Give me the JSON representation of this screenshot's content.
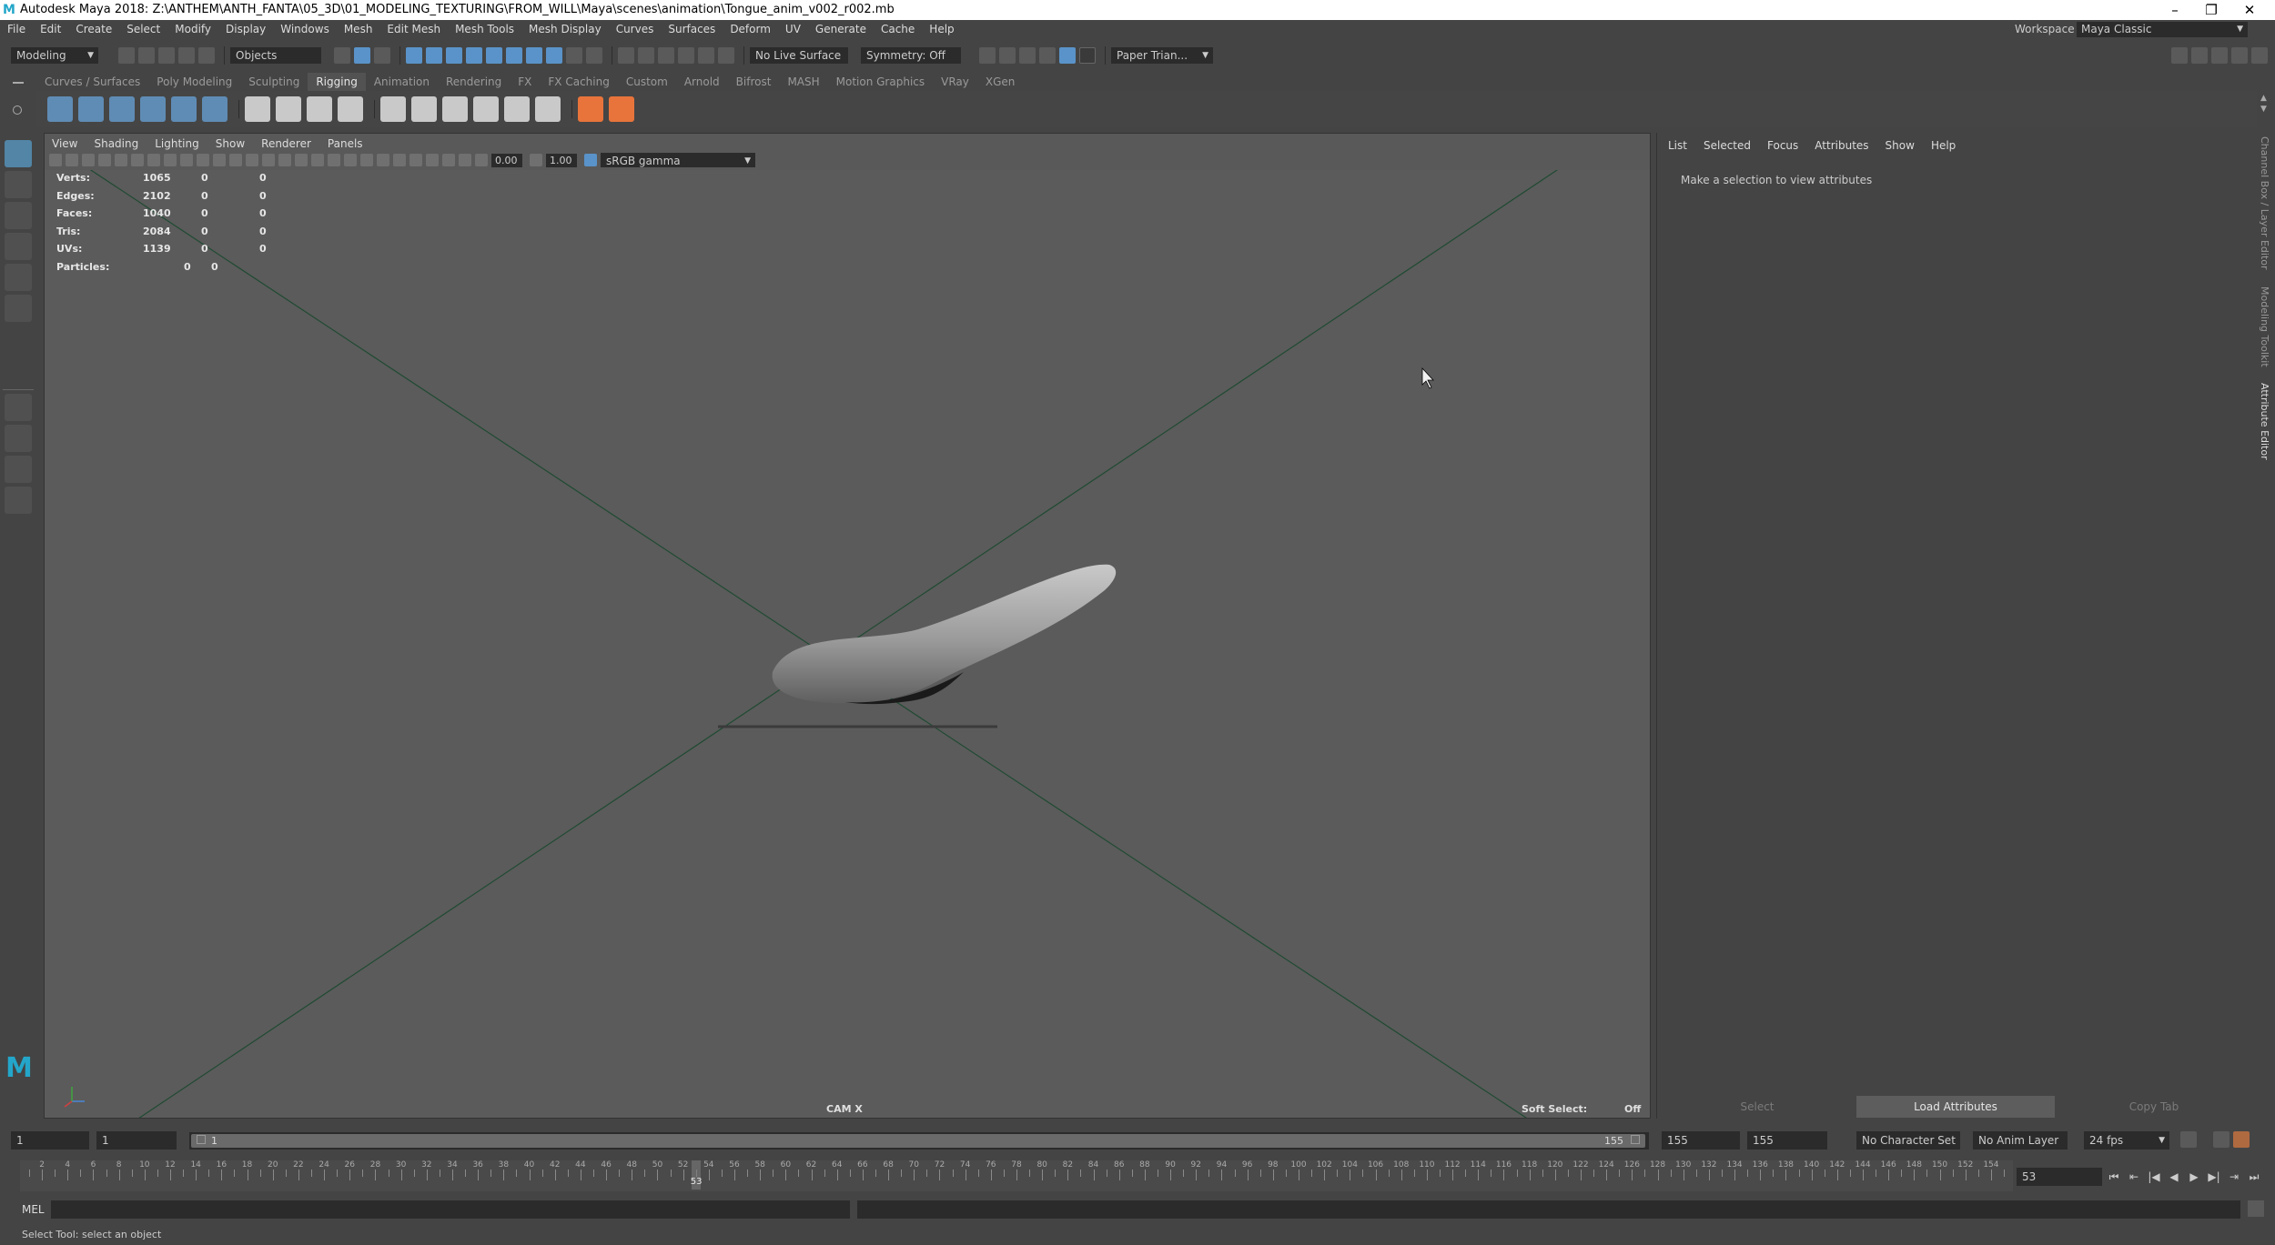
{
  "window": {
    "title": "Autodesk Maya 2018: Z:\\ANTHEM\\ANTH_FANTA\\05_3D\\01_MODELING_TEXTURING\\FROM_WILL\\Maya\\scenes\\animation\\Tongue_anim_v002_r002.mb",
    "logo": "M",
    "minimize": "–",
    "restore": "❐",
    "close": "✕"
  },
  "menubar": {
    "items": [
      "File",
      "Edit",
      "Create",
      "Select",
      "Modify",
      "Display",
      "Windows",
      "Mesh",
      "Edit Mesh",
      "Mesh Tools",
      "Mesh Display",
      "Curves",
      "Surfaces",
      "Deform",
      "UV",
      "Generate",
      "Cache",
      "Help"
    ],
    "workspace_label": "Workspace :",
    "workspace_value": "Maya Classic"
  },
  "statusline": {
    "mode": "Modeling",
    "selection_mode": "Objects",
    "live_surface": "No Live Surface",
    "symmetry": "Symmetry: Off",
    "user": "Paper Trian..."
  },
  "shelf": {
    "tabs": [
      "Curves / Surfaces",
      "Poly Modeling",
      "Sculpting",
      "Rigging",
      "Animation",
      "Rendering",
      "FX",
      "FX Caching",
      "Custom",
      "Arnold",
      "Bifrost",
      "MASH",
      "Motion Graphics",
      "VRay",
      "XGen"
    ],
    "active_tab": "Rigging"
  },
  "viewport": {
    "menu": [
      "View",
      "Shading",
      "Lighting",
      "Show",
      "Renderer",
      "Panels"
    ],
    "exposure": "0.00",
    "gamma": "1.00",
    "color_space": "sRGB gamma",
    "camera": "CAM X",
    "soft_select_label": "Soft Select:",
    "soft_select_value": "Off",
    "hud": [
      {
        "label": "Verts:",
        "v1": "1065",
        "v2": "0",
        "v3": "0"
      },
      {
        "label": "Edges:",
        "v1": "2102",
        "v2": "0",
        "v3": "0"
      },
      {
        "label": "Faces:",
        "v1": "1040",
        "v2": "0",
        "v3": "0"
      },
      {
        "label": "Tris:",
        "v1": "2084",
        "v2": "0",
        "v3": "0"
      },
      {
        "label": "UVs:",
        "v1": "1139",
        "v2": "0",
        "v3": "0"
      },
      {
        "label": "Particles:",
        "v1": "0",
        "v2": "0",
        "v3": ""
      }
    ]
  },
  "attribute_editor": {
    "menu": [
      "List",
      "Selected",
      "Focus",
      "Attributes",
      "Show",
      "Help"
    ],
    "hint": "Make a selection to view attributes",
    "select_btn": "Select",
    "load_btn": "Load Attributes",
    "copy_btn": "Copy Tab",
    "side_tabs": [
      "Channel Box / Layer Editor",
      "Modeling Toolkit",
      "Attribute Editor"
    ]
  },
  "range": {
    "start": "1",
    "playback_start": "1",
    "slider_start": "1",
    "slider_end": "155",
    "playback_end": "155",
    "end": "155",
    "character_set": "No Character Set",
    "anim_layer": "No Anim Layer",
    "fps": "24 fps"
  },
  "timeline": {
    "start": 1,
    "end": 155,
    "current_frame": 53,
    "current_frame_text": "53",
    "playback_buttons": [
      "⏮",
      "⏭",
      "◀|",
      "◀",
      "▶",
      "|▶",
      "⏭",
      "⏮"
    ]
  },
  "command_line": {
    "label": "MEL",
    "help": "Select Tool: select an object"
  },
  "colors": {
    "accent": "#5285a6",
    "background": "#444444",
    "viewport": "#5b5b5b",
    "grid_lines": "#1f4a32"
  }
}
